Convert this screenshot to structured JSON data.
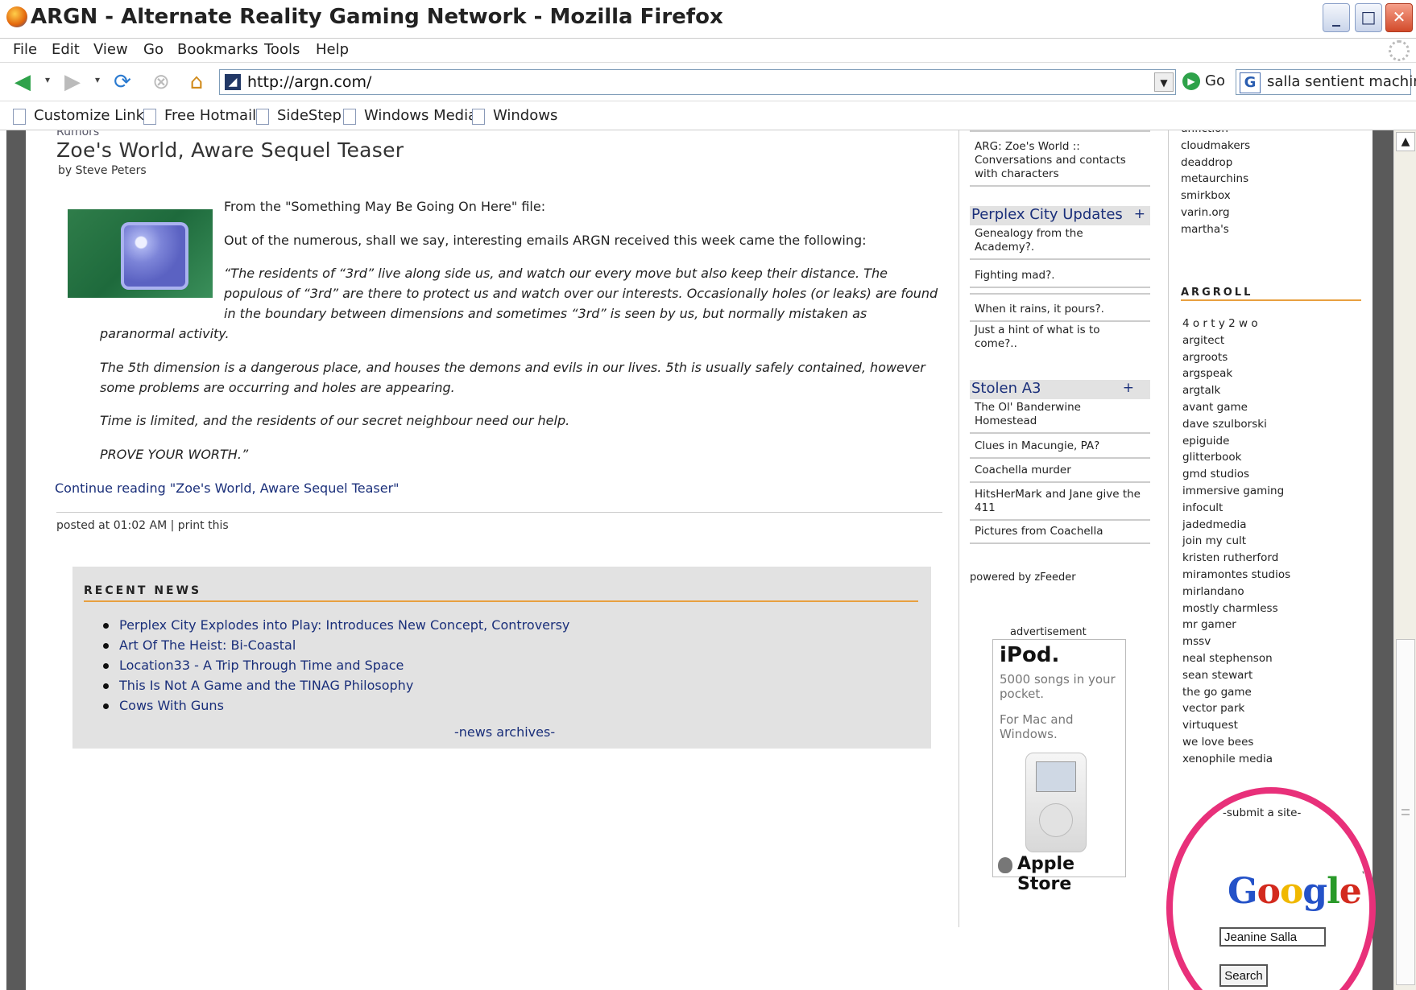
{
  "window": {
    "title": "ARGN - Alternate Reality Gaming Network - Mozilla Firefox",
    "buttons": [
      "_",
      "□",
      "✕"
    ]
  },
  "menu": [
    "File",
    "Edit",
    "View",
    "Go",
    "Bookmarks",
    "Tools",
    "Help"
  ],
  "nav": {
    "url": "http://argn.com/",
    "go_label": "Go",
    "search_value": "salla sentient machine"
  },
  "bookmarks": [
    "Customize Links",
    "Free Hotmail",
    "SideStep",
    "Windows Media",
    "Windows"
  ],
  "post": {
    "category": "Rumors",
    "title": "Zoe's World, Aware Sequel Teaser",
    "byline": "by Steve Peters",
    "intro": "From the \"Something May Be Going On Here\" file:",
    "lead": "Out of the numerous, shall we say, interesting emails ARGN received this week came the following:",
    "quote_1a": "“The residents of “3rd” live along side us, and watch our every move but also keep their distance. The",
    "quote_1b": "populous of “3rd” are there to protect us and watch over our interests. Occasionally holes (or leaks) are found",
    "quote_1c": "in the boundary between dimensions and sometimes “3rd” is seen by us, but normally mistaken as",
    "quote_1d": "paranormal activity.",
    "quote_2a": "The 5th dimension is a dangerous place, and houses the demons and evils in our lives. 5th is usually safely contained, however",
    "quote_2b": "some problems are occurring and holes are appearing.",
    "quote_3": "Time is limited, and the residents of our secret neighbour need our help.",
    "quote_4": "PROVE YOUR WORTH.”",
    "continue": "Continue reading \"Zoe's World, Aware Sequel Teaser\"",
    "footer": "posted at 01:02 AM | print this"
  },
  "recent_news": {
    "heading": "RECENT NEWS",
    "items": [
      "Perplex City Explodes into Play: Introduces New Concept, Controversy",
      "Art Of The Heist: Bi-Coastal",
      "Location33 - A Trip Through Time and Space",
      "This Is Not A Game and the TINAG Philosophy",
      "Cows With Guns"
    ],
    "archives": "-news archives-"
  },
  "middle": {
    "top_item": "ARG: Zoe's World :: Conversations and contacts with characters",
    "perplex_heading": "Perplex City Updates",
    "perplex_items": [
      "Genealogy from the Academy?.",
      "Fighting mad?.",
      "When it rains, it pours?.",
      "Just a hint of what is to come?.."
    ],
    "stolen_heading": "Stolen A3",
    "stolen_items": [
      "The Ol' Banderwine Homestead",
      "Clues in Macungie, PA?",
      "Coachella murder",
      "HitsHerMark and Jane give the 411",
      "Pictures from Coachella"
    ],
    "plus": "+",
    "powered": "powered by zFeeder"
  },
  "ad": {
    "label": "advertisement",
    "product": "iPod.",
    "line1": "5000 songs in your pocket.",
    "line2": "For Mac and Windows.",
    "store": "Apple Store"
  },
  "right": {
    "top_links": [
      "unfiction",
      "cloudmakers",
      "deaddrop",
      "metaurchins",
      "smirkbox",
      "varin.org",
      "martha's"
    ],
    "argroll_heading": "ARGROLL",
    "argroll": [
      "4 o r t y 2 w o",
      "argitect",
      "argroots",
      "argspeak",
      "argtalk",
      "avant game",
      "dave szulborski",
      "epiguide",
      "glitterbook",
      "gmd studios",
      "immersive gaming",
      "infocult",
      "jadedmedia",
      "join my cult",
      "kristen rutherford",
      "miramontes studios",
      "mirlandano",
      "mostly charmless",
      "mr gamer",
      "mssv",
      "neal stephenson",
      "sean stewart",
      "the go game",
      "vector park",
      "virtuquest",
      "we love bees",
      "xenophile media"
    ],
    "submit": "-submit a site-",
    "google_letters": [
      "G",
      "o",
      "o",
      "g",
      "l",
      "e"
    ],
    "google_tm": "™",
    "search_input": "Jeanine Salla",
    "search_button": "Search"
  },
  "colors": {
    "accent_rule": "#e8a040",
    "link": "#1a2f7a",
    "highlight_circle": "#e8307a",
    "google": [
      "#2452c8",
      "#d32a1e",
      "#f0b800",
      "#2452c8",
      "#2a9a2a",
      "#d32a1e"
    ]
  }
}
